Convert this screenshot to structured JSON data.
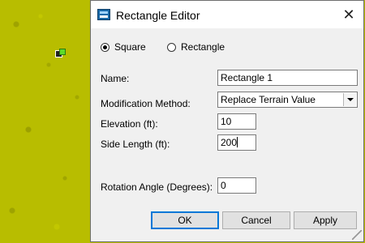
{
  "dialog": {
    "title": "Rectangle Editor",
    "close_symbol": "✕"
  },
  "shape_options": {
    "square_label": "Square",
    "rectangle_label": "Rectangle",
    "selected": "Square"
  },
  "fields": {
    "name_label": "Name:",
    "name_value": "Rectangle 1",
    "method_label": "Modification Method:",
    "method_value": "Replace Terrain Value",
    "elevation_label": "Elevation (ft):",
    "elevation_value": "10",
    "side_length_label": "Side Length (ft):",
    "side_length_value": "200",
    "rotation_label": "Rotation Angle (Degrees):",
    "rotation_value": "0"
  },
  "buttons": {
    "ok": "OK",
    "cancel": "Cancel",
    "apply": "Apply"
  },
  "icons": {
    "app": "rectangle-editor-app-icon",
    "marker": "map-marker-icon",
    "close": "close-icon",
    "dropdown": "chevron-down-icon",
    "grip": "resize-grip-icon"
  },
  "colors": {
    "terrain": "#b8bd00",
    "dialog_bg": "#f0f0f0",
    "focus_border": "#0078d7"
  }
}
